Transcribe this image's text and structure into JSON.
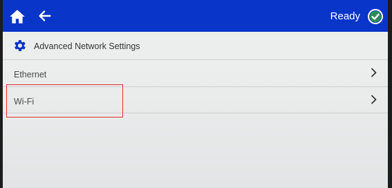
{
  "topbar": {
    "home_icon": "home-icon",
    "back_icon": "back-arrow-icon",
    "status_text": "Ready",
    "status_icon": "check-circle-icon"
  },
  "header": {
    "icon": "gear-icon",
    "title": "Advanced Network Settings"
  },
  "list": {
    "items": [
      {
        "label": "Ethernet",
        "icon": "chevron-right-icon"
      },
      {
        "label": "Wi-Fi",
        "icon": "chevron-right-icon"
      }
    ]
  },
  "colors": {
    "topbar": "#0a35c9",
    "highlight": "#e0302a"
  }
}
